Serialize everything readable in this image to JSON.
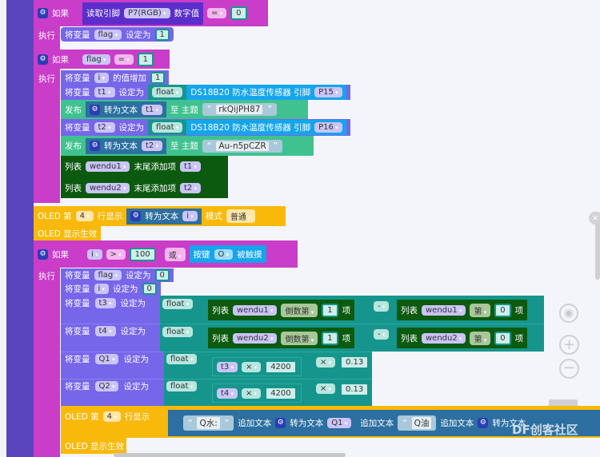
{
  "colors": {
    "if": "#c93dc9",
    "variable": "#7566ea",
    "math": "#16958d",
    "mqtt": "#3fc290",
    "sensor": "#15a5ec",
    "list": "#0c5a10",
    "oled": "#f8b90a",
    "text": "#2c6fa0"
  },
  "kw": {
    "if": "如果",
    "do": "执行",
    "set_var": "将变量",
    "set_to": "设定为",
    "increase": "的值增加",
    "publish": "发布",
    "to_text": "转为文本",
    "to_topic": "至 主题",
    "list": "列表",
    "append": "末尾添加项",
    "oled_line_pre": "OLED 第",
    "oled_line_show": "行显示",
    "mode": "模式",
    "oled_apply": "OLED 显示生效",
    "or": "或",
    "item": "项",
    "append_text": "追加文本",
    "float": "float",
    "quote_l": "“",
    "quote_r": "”"
  },
  "block1": {
    "read_pin": "读取引脚",
    "pin": "P7(RGB)",
    "digital": "数字值",
    "op": "=",
    "value": "0",
    "var": "flag",
    "set_value": "1"
  },
  "block2": {
    "var": "flag",
    "op": "=",
    "value": "1",
    "inc_var": "i",
    "inc_value": "1",
    "t1": {
      "var": "t1",
      "sensor": "DS18B20 防水温度传感器 引脚",
      "pin": "P15",
      "topic": "rkQijPH87"
    },
    "t2": {
      "var": "t2",
      "sensor": "DS18B20 防水温度传感器 引脚",
      "pin": "P16",
      "topic": "Au-n5pCZR"
    },
    "lists": [
      {
        "name": "wendu1",
        "item": "t1"
      },
      {
        "name": "wendu2",
        "item": "t2"
      }
    ]
  },
  "oled1": {
    "line": "4",
    "var": "i",
    "mode": "普通"
  },
  "block3": {
    "var": "i",
    "op": ">",
    "value": "100",
    "or_op": "或",
    "button_pre": "按键",
    "button": "O",
    "button_post": "被触摸",
    "flag": "flag",
    "flag_value": "0",
    "i": "i",
    "i_value": "0",
    "t3": {
      "var": "t3",
      "list": "wendu1",
      "from_end": "倒数第",
      "idx1": "1",
      "minus": "-",
      "list2": "wendu1",
      "nth": "第",
      "idx2": "0"
    },
    "t4": {
      "var": "t4",
      "list": "wendu2",
      "from_end": "倒数第",
      "idx1": "1",
      "minus": "-",
      "list2": "wendu2",
      "nth": "第",
      "idx2": "0"
    },
    "q1": {
      "var": "Q1",
      "a": "t3",
      "mul": "×",
      "b": "4200",
      "mul2": "×",
      "c": "0.13"
    },
    "q2": {
      "var": "Q2",
      "a": "t4",
      "mul": "×",
      "b": "4200",
      "mul2": "×",
      "c": "0.13"
    },
    "oled": {
      "line": "4",
      "label": "Q水:",
      "var": "Q1",
      "label2": "Q油"
    }
  },
  "watermark": "DF创客社区"
}
